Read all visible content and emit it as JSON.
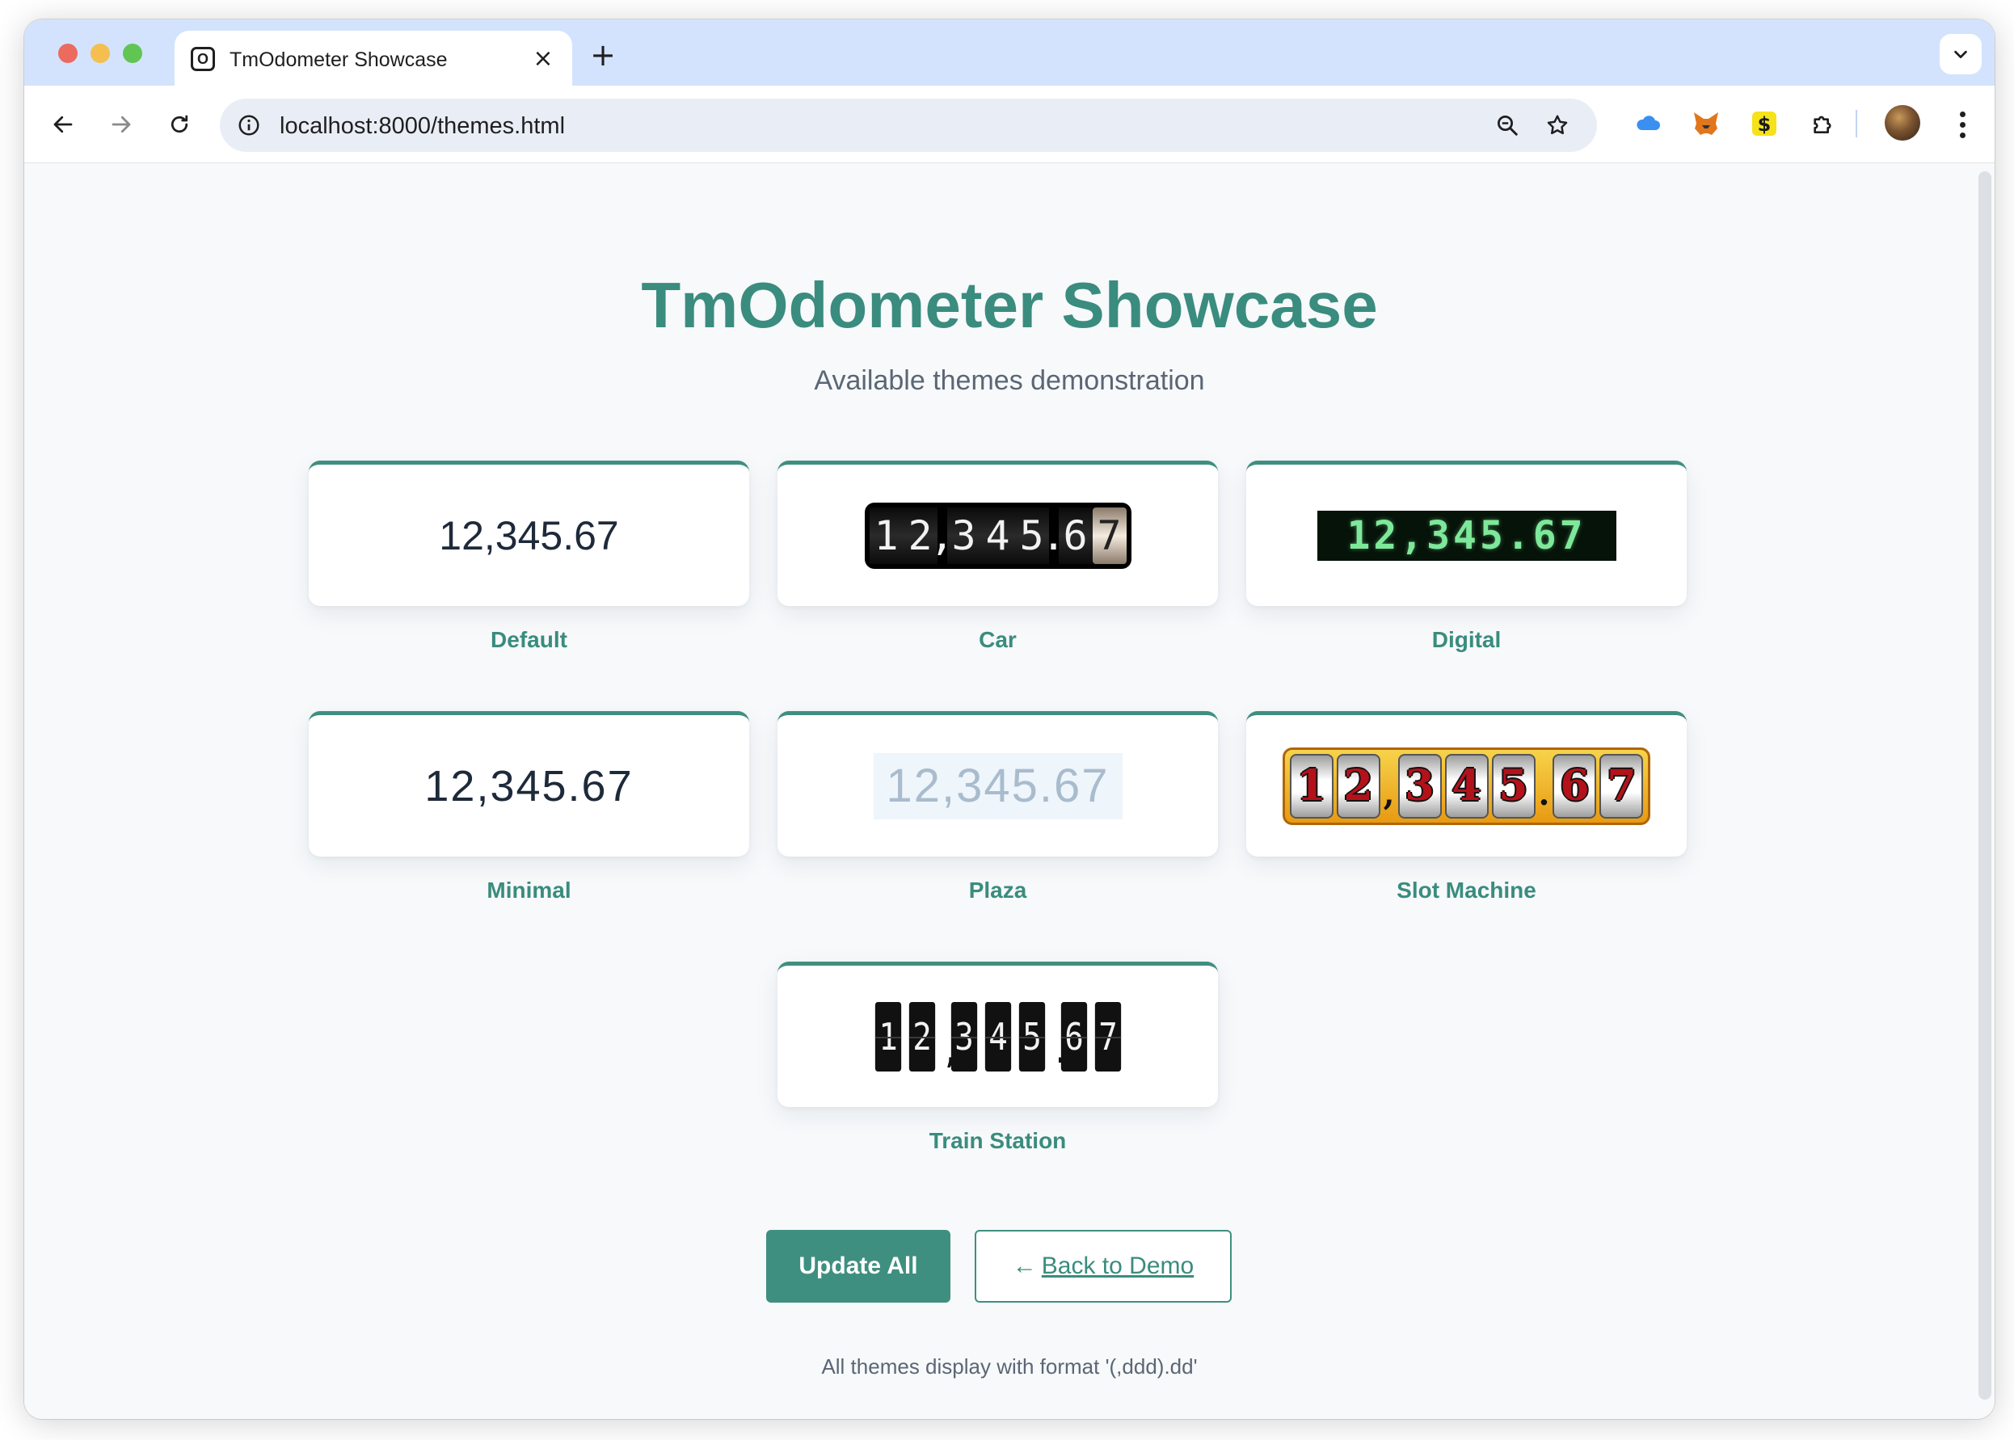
{
  "browser": {
    "tab_title": "TmOdometer Showcase",
    "tab_favicon_letter": "O",
    "url": "localhost:8000/themes.html"
  },
  "page": {
    "title": "TmOdometer Showcase",
    "subtitle": "Available themes demonstration",
    "value": "12,345.67",
    "themes": [
      {
        "label": "Default"
      },
      {
        "label": "Car"
      },
      {
        "label": "Digital"
      },
      {
        "label": "Minimal"
      },
      {
        "label": "Plaza"
      },
      {
        "label": "Slot Machine"
      },
      {
        "label": "Train Station"
      }
    ],
    "buttons": {
      "update_all": "Update All",
      "back_arrow": "←",
      "back_to_demo": "Back to Demo"
    },
    "footnote": "All themes display with format '(,ddd).dd'"
  },
  "icons": [
    "back-icon",
    "forward-icon",
    "reload-icon",
    "info-icon",
    "zoom-icon",
    "star-icon",
    "cloud-extension-icon",
    "fox-extension-icon",
    "dollar-extension-icon",
    "puzzle-icon",
    "avatar",
    "kebab-menu-icon",
    "chevron-down-icon",
    "close-icon",
    "plus-icon"
  ],
  "colors": {
    "accent": "#3f8f80",
    "title": "#3a8c7e",
    "tabstrip": "#d3e3fd"
  }
}
